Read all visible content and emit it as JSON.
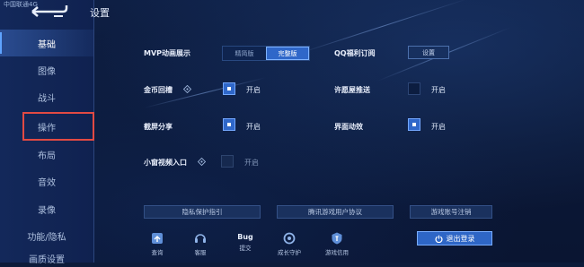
{
  "header": {
    "brand": "中国联通4G",
    "title": "设置"
  },
  "sidebar": {
    "items": [
      {
        "label": "基础",
        "active": true
      },
      {
        "label": "图像",
        "active": false
      },
      {
        "label": "战斗",
        "active": false
      },
      {
        "label": "操作",
        "active": false
      },
      {
        "label": "布局",
        "active": false
      },
      {
        "label": "音效",
        "active": false
      },
      {
        "label": "录像",
        "active": false
      },
      {
        "label": "功能/隐私",
        "active": false
      },
      {
        "label": "画质设置",
        "active": false
      }
    ],
    "highlighted": "操作"
  },
  "settings": {
    "mvp": {
      "label": "MVP动画展示",
      "options": [
        "精简版",
        "完整版"
      ],
      "selected": "完整版"
    },
    "qq": {
      "label": "QQ福利订阅",
      "button": "设置"
    },
    "coin": {
      "label": "金币回槽",
      "state": "开启",
      "checked": true
    },
    "wish": {
      "label": "许愿屋推送",
      "state": "开启",
      "checked": false
    },
    "share": {
      "label": "截屏分享",
      "state": "开启",
      "checked": true
    },
    "anim": {
      "label": "界面动效",
      "state": "开启",
      "checked": true
    },
    "window": {
      "label": "小窗视频入口",
      "state": "开启",
      "checked": false
    }
  },
  "links": [
    "隐私保护指引",
    "腾讯游戏用户协议",
    "游戏账号注销"
  ],
  "bottom": [
    {
      "label": "查询",
      "icon": "search-icon"
    },
    {
      "label": "客服",
      "icon": "customer-service-icon"
    },
    {
      "label": "提交",
      "icon": "bug-icon",
      "title": "Bug"
    },
    {
      "label": "成长守护",
      "icon": "growth-guard-icon"
    },
    {
      "label": "游戏信用",
      "icon": "credit-shield-icon"
    }
  ],
  "logout": {
    "label": "退出登录"
  },
  "colors": {
    "accent": "#2f67c9",
    "highlight": "#e24a43",
    "background": "#0c1b3a"
  }
}
